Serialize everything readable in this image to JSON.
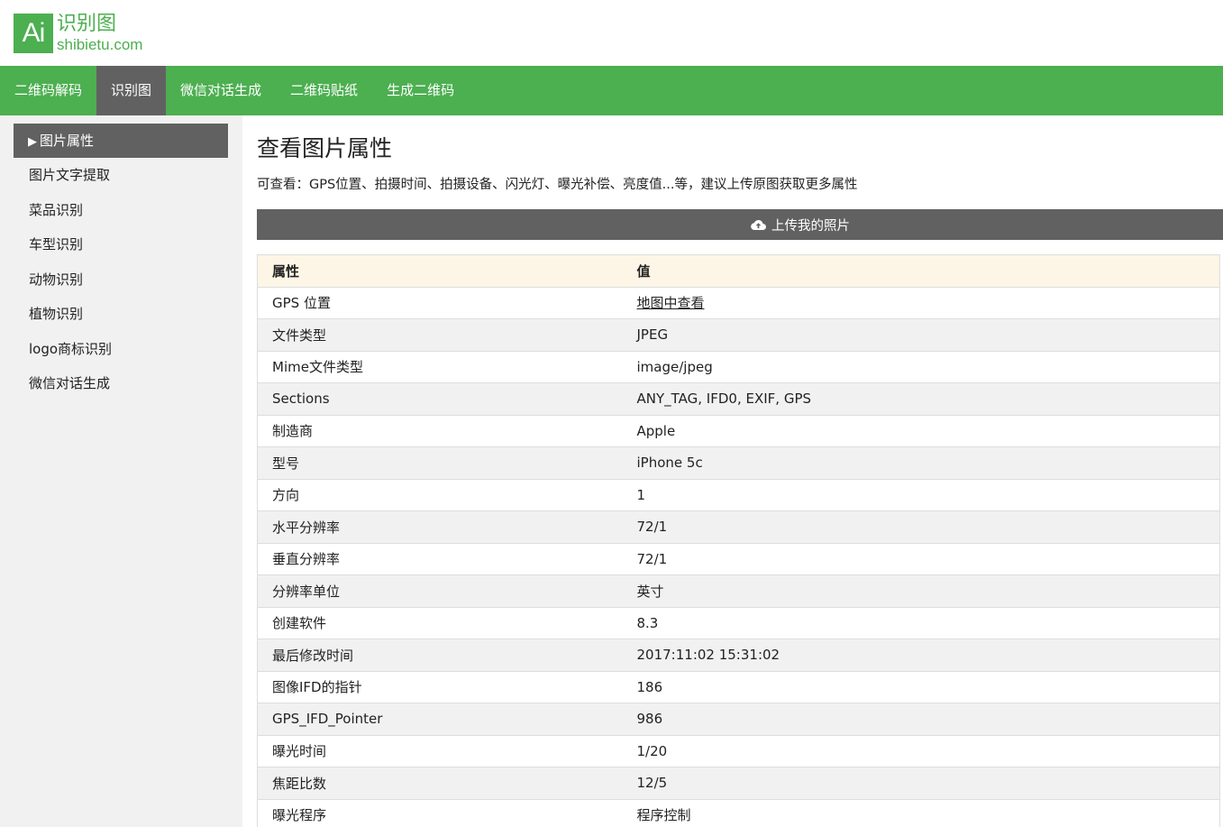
{
  "logo": {
    "mark": "Ai",
    "name_cn": "识别图",
    "domain": "shibietu.com",
    "brand_color": "#4caf50"
  },
  "topnav": [
    {
      "label": "二维码解码",
      "active": false
    },
    {
      "label": "识别图",
      "active": true
    },
    {
      "label": "微信对话生成",
      "active": false
    },
    {
      "label": "二维码贴纸",
      "active": false
    },
    {
      "label": "生成二维码",
      "active": false
    }
  ],
  "sidebar": {
    "active_label": "图片属性",
    "active_icon": "triangle-right-icon",
    "items": [
      {
        "label": "图片文字提取"
      },
      {
        "label": "菜品识别"
      },
      {
        "label": "车型识别"
      },
      {
        "label": "动物识别"
      },
      {
        "label": "植物识别"
      },
      {
        "label": "logo商标识别"
      },
      {
        "label": "微信对话生成"
      }
    ]
  },
  "main": {
    "title": "查看图片属性",
    "description": "可查看：GPS位置、拍摄时间、拍摄设备、闪光灯、曝光补偿、亮度值...等，建议上传原图获取更多属性",
    "upload_button": {
      "label": "上传我的照片",
      "icon": "cloud-upload-icon"
    },
    "table": {
      "headers": [
        "属性",
        "值"
      ],
      "rows": [
        {
          "key": "GPS 位置",
          "value": "地图中查看",
          "link": true
        },
        {
          "key": "文件类型",
          "value": "JPEG"
        },
        {
          "key": "Mime文件类型",
          "value": "image/jpeg"
        },
        {
          "key": "Sections",
          "value": "ANY_TAG, IFD0, EXIF, GPS"
        },
        {
          "key": "制造商",
          "value": "Apple"
        },
        {
          "key": "型号",
          "value": "iPhone 5c"
        },
        {
          "key": "方向",
          "value": "1"
        },
        {
          "key": "水平分辨率",
          "value": "72/1"
        },
        {
          "key": "垂直分辨率",
          "value": "72/1"
        },
        {
          "key": "分辨率单位",
          "value": "英寸"
        },
        {
          "key": "创建软件",
          "value": "8.3"
        },
        {
          "key": "最后修改时间",
          "value": "2017:11:02 15:31:02"
        },
        {
          "key": "图像IFD的指针",
          "value": "186"
        },
        {
          "key": "GPS_IFD_Pointer",
          "value": "986"
        },
        {
          "key": "曝光时间",
          "value": "1/20"
        },
        {
          "key": "焦距比数",
          "value": "12/5"
        },
        {
          "key": "曝光程序",
          "value": "程序控制"
        }
      ]
    }
  }
}
